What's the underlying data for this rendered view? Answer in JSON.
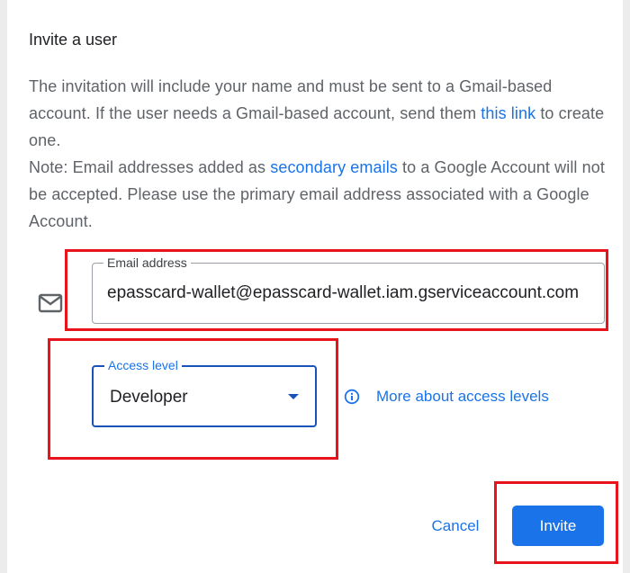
{
  "dialog": {
    "title": "Invite a user",
    "description": {
      "line1_pre": "The invitation will include your name and must be sent to a Gmail-based account. If the user needs a Gmail-based account, send them ",
      "this_link": "this link",
      "line1_post": " to create one.",
      "note_pre": "Note: Email addresses added as ",
      "secondary_emails_link": "secondary emails",
      "note_post": " to a Google Account will not be accepted. Please use the primary email address associated with a Google Account."
    },
    "email_field": {
      "label": "Email address",
      "value": "epasscard-wallet@epasscard-wallet.iam.gserviceaccount.com",
      "icon": "mail-icon"
    },
    "access_level": {
      "label": "Access level",
      "selected": "Developer"
    },
    "more_about_link": "More about access levels",
    "buttons": {
      "cancel": "Cancel",
      "invite": "Invite"
    }
  },
  "colors": {
    "accent": "#1a73e8",
    "highlight": "#e8141c",
    "text_primary": "#202124",
    "text_secondary": "#5f6368"
  }
}
